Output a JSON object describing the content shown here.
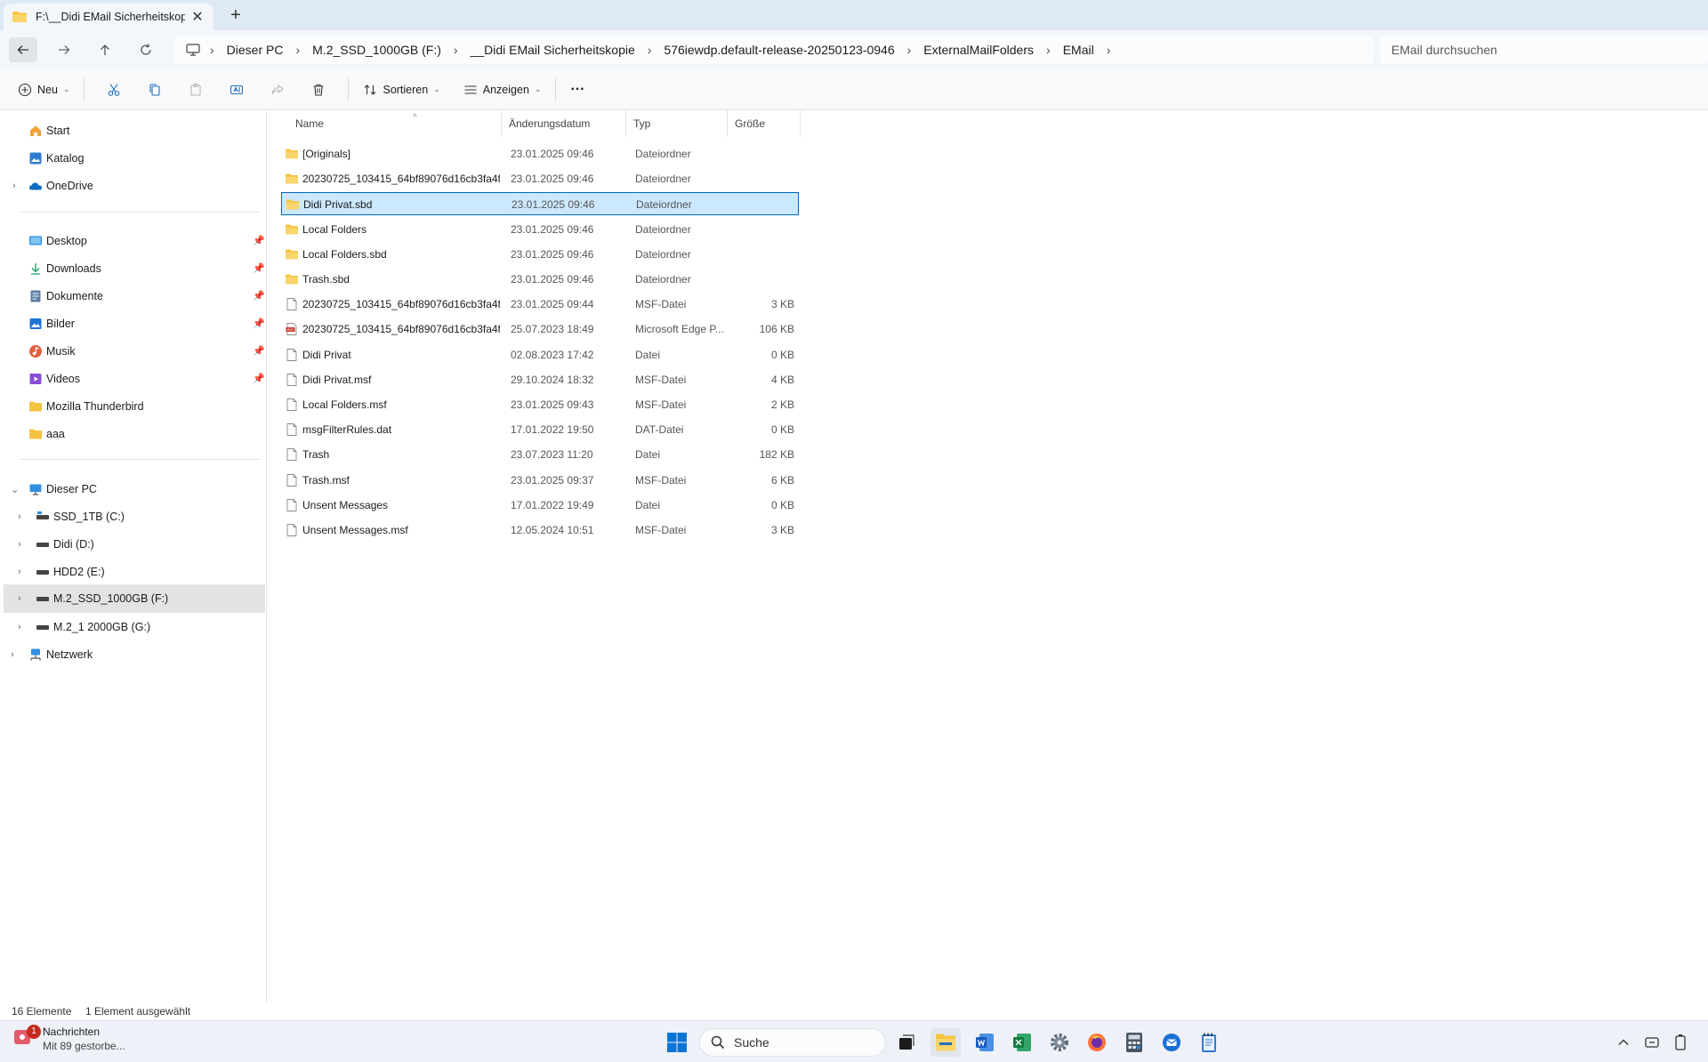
{
  "window": {
    "tab_title": "F:\\__Didi EMail Sicherheitskopi",
    "tab_close": "✕",
    "new_tab": "+"
  },
  "address": {
    "crumbs": [
      "Dieser PC",
      "M.2_SSD_1000GB (F:)",
      "__Didi EMail Sicherheitskopie",
      "576iewdp.default-release-20250123-0946",
      "ExternalMailFolders",
      "EMail"
    ],
    "search_placeholder": "EMail durchsuchen"
  },
  "commands": {
    "new": "Neu",
    "sort": "Sortieren",
    "view": "Anzeigen",
    "more": "···"
  },
  "sidebar": {
    "quick": [
      {
        "label": "Start",
        "icon": "home-icon"
      },
      {
        "label": "Katalog",
        "icon": "gallery-icon"
      },
      {
        "label": "OneDrive",
        "icon": "onedrive-icon"
      }
    ],
    "pinned": [
      {
        "label": "Desktop",
        "icon": "desktop-icon"
      },
      {
        "label": "Downloads",
        "icon": "download-icon"
      },
      {
        "label": "Dokumente",
        "icon": "documents-icon"
      },
      {
        "label": "Bilder",
        "icon": "pictures-icon"
      },
      {
        "label": "Musik",
        "icon": "music-icon"
      },
      {
        "label": "Videos",
        "icon": "videos-icon"
      },
      {
        "label": "Mozilla Thunderbird",
        "icon": "folder-icon"
      },
      {
        "label": "aaa",
        "icon": "folder-icon"
      }
    ],
    "this_pc": "Dieser PC",
    "drives": [
      "SSD_1TB (C:)",
      "Didi (D:)",
      "HDD2 (E:)",
      "M.2_SSD_1000GB (F:)",
      "M.2_1 2000GB (G:)"
    ],
    "network": "Netzwerk"
  },
  "columns": {
    "name": "Name",
    "date": "Änderungsdatum",
    "type": "Typ",
    "size": "Größe"
  },
  "files": [
    {
      "name": "[Originals]",
      "date": "23.01.2025 09:46",
      "type": "Dateiordner",
      "size": "",
      "kind": "folder"
    },
    {
      "name": "20230725_103415_64bf89076d16cb3fa4f...",
      "date": "23.01.2025 09:46",
      "type": "Dateiordner",
      "size": "",
      "kind": "folder"
    },
    {
      "name": "Didi Privat.sbd",
      "date": "23.01.2025 09:46",
      "type": "Dateiordner",
      "size": "",
      "kind": "folder",
      "selected": true
    },
    {
      "name": "Local Folders",
      "date": "23.01.2025 09:46",
      "type": "Dateiordner",
      "size": "",
      "kind": "folder"
    },
    {
      "name": "Local Folders.sbd",
      "date": "23.01.2025 09:46",
      "type": "Dateiordner",
      "size": "",
      "kind": "folder"
    },
    {
      "name": "Trash.sbd",
      "date": "23.01.2025 09:46",
      "type": "Dateiordner",
      "size": "",
      "kind": "folder"
    },
    {
      "name": "20230725_103415_64bf89076d16cb3fa4f...",
      "date": "23.01.2025 09:44",
      "type": "MSF-Datei",
      "size": "3 KB",
      "kind": "file"
    },
    {
      "name": "20230725_103415_64bf89076d16cb3fa4f...",
      "date": "25.07.2023 18:49",
      "type": "Microsoft Edge P...",
      "size": "106 KB",
      "kind": "pdf"
    },
    {
      "name": "Didi Privat",
      "date": "02.08.2023 17:42",
      "type": "Datei",
      "size": "0 KB",
      "kind": "file"
    },
    {
      "name": "Didi Privat.msf",
      "date": "29.10.2024 18:32",
      "type": "MSF-Datei",
      "size": "4 KB",
      "kind": "file"
    },
    {
      "name": "Local Folders.msf",
      "date": "23.01.2025 09:43",
      "type": "MSF-Datei",
      "size": "2 KB",
      "kind": "file"
    },
    {
      "name": "msgFilterRules.dat",
      "date": "17.01.2022 19:50",
      "type": "DAT-Datei",
      "size": "0 KB",
      "kind": "file"
    },
    {
      "name": "Trash",
      "date": "23.07.2023 11:20",
      "type": "Datei",
      "size": "182 KB",
      "kind": "file"
    },
    {
      "name": "Trash.msf",
      "date": "23.01.2025 09:37",
      "type": "MSF-Datei",
      "size": "6 KB",
      "kind": "file"
    },
    {
      "name": "Unsent Messages",
      "date": "17.01.2022 19:49",
      "type": "Datei",
      "size": "0 KB",
      "kind": "file"
    },
    {
      "name": "Unsent Messages.msf",
      "date": "12.05.2024 10:51",
      "type": "MSF-Datei",
      "size": "3 KB",
      "kind": "file"
    }
  ],
  "status": {
    "count": "16 Elemente",
    "selected": "1 Element ausgewählt"
  },
  "taskbar": {
    "notification_title": "Nachrichten",
    "notification_text": "Mit 89 gestorbe...",
    "notification_badge": "1",
    "search_label": "Suche"
  },
  "colors": {
    "accent": "#0067c0",
    "selection": "#cce8ff",
    "folder": "#f5c342"
  }
}
